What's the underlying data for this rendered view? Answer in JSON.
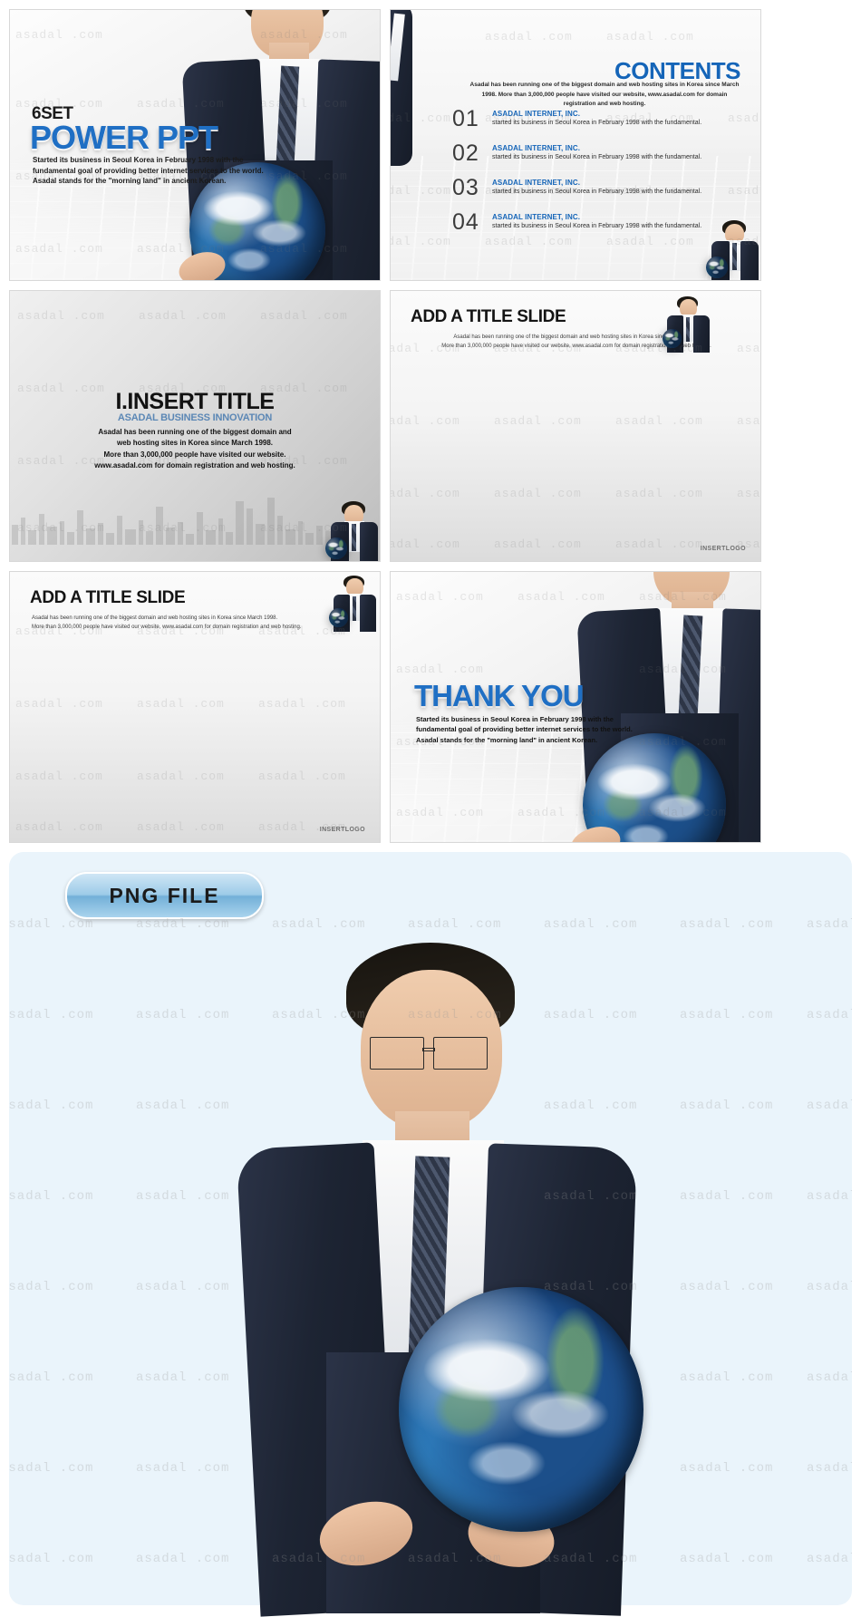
{
  "watermark": {
    "text": "asadal .com"
  },
  "slides": [
    {
      "id": "cover",
      "eyebrow": "6SET",
      "title": "POWER PPT",
      "body": "Started its business in Seoul Korea in February 1998 with the fundamental goal of providing better internet services to the world. Asadal stands for the \"morning land\" in ancient Korean."
    },
    {
      "id": "contents",
      "heading": "CONTENTS",
      "lead": "Asadal has been running one of the biggest domain and web hosting sites in Korea since March 1998. More than 3,000,000 people have visited our website, www.asadal.com for domain registration and web hosting.",
      "items": [
        {
          "num": "01",
          "title": "ASADAL INTERNET, INC.",
          "desc": "started its business in Seoul Korea in February 1998 with the fundamental."
        },
        {
          "num": "02",
          "title": "ASADAL INTERNET, INC.",
          "desc": "started its business in Seoul Korea in February 1998 with the fundamental."
        },
        {
          "num": "03",
          "title": "ASADAL INTERNET, INC.",
          "desc": "started its business in Seoul Korea in February 1998 with the fundamental."
        },
        {
          "num": "04",
          "title": "ASADAL INTERNET, INC.",
          "desc": "started its business in Seoul Korea in February 1998 with the fundamental."
        }
      ]
    },
    {
      "id": "insert-title",
      "title": "I.INSERT TITLE",
      "subtitle": "ASADAL BUSINESS INNOVATION",
      "body_line1": "Asadal has been running one of the biggest domain and",
      "body_line2": "web hosting sites in Korea since March 1998.",
      "body_line3": "More than 3,000,000 people have visited our website.",
      "body_line4": "www.asadal.com for domain registration and web hosting."
    },
    {
      "id": "title-slide-a",
      "heading": "ADD A TITLE SLIDE",
      "body_line1": "Asadal has been running one of the biggest domain and web hosting sites in Korea since March 1998.",
      "body_line2": "More than 3,000,000 people have visited our website, www.asadal.com for domain registration and web hosting.",
      "footer_logo": "INSERTLOGO"
    },
    {
      "id": "title-slide-b",
      "heading": "ADD A TITLE SLIDE",
      "body_line1": "Asadal has been running one of the biggest domain and web hosting sites in Korea since March 1998.",
      "body_line2": "More than 3,000,000 people have visited our website, www.asadal.com for domain registration and web hosting.",
      "footer_logo": "INSERTLOGO"
    },
    {
      "id": "thank-you",
      "title": "THANK YOU",
      "body": "Started its business in Seoul Korea in February 1998 with the fundamental goal of providing better internet services to the world. Asadal stands for the \"morning land\" in ancient Korean."
    }
  ],
  "png_panel": {
    "button_label": "PNG FILE"
  },
  "colors": {
    "accent_blue": "#1f6fc4",
    "contents_blue": "#1565b8",
    "subtitle_blue": "#5b87b5",
    "panel_bg": "#eaf4fb",
    "text_dark": "#141414"
  }
}
